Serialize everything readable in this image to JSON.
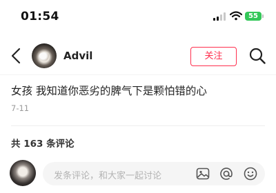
{
  "status_bar": {
    "time": "01:54",
    "battery": "55"
  },
  "header": {
    "username": "Advil",
    "follow_label": "关注"
  },
  "post": {
    "text": "女孩 我知道你恶劣的脾气下是颗怕错的心",
    "date": "7-11"
  },
  "comments": {
    "count_label": "共 163 条评论"
  },
  "comment_input": {
    "placeholder": "发条评论，和大家一起讨论"
  },
  "colors": {
    "accent": "#ff2e4d",
    "battery": "#34c759",
    "input_bg": "#f5f5f5",
    "muted": "#9a9a9a"
  },
  "icons": [
    "back-arrow-icon",
    "search-icon",
    "image-icon",
    "at-icon",
    "emoji-icon",
    "signal-icon",
    "wifi-icon",
    "battery-icon"
  ]
}
